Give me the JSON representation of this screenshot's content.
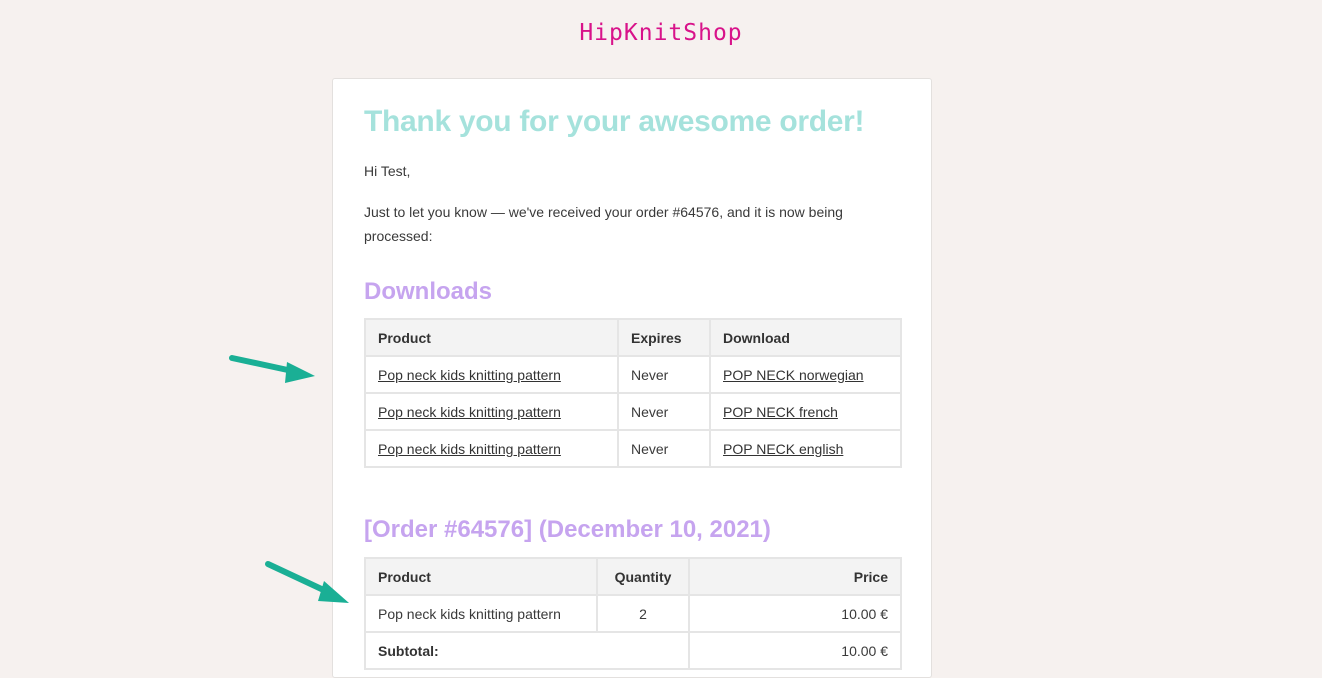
{
  "shop": {
    "logo": "HipKnitShop"
  },
  "email": {
    "heading": "Thank you for your awesome order!",
    "greeting": "Hi Test,",
    "intro": "Just to let you know — we've received your order #64576, and it is now being processed:"
  },
  "downloads": {
    "title": "Downloads",
    "headers": {
      "product": "Product",
      "expires": "Expires",
      "download": "Download"
    },
    "rows": [
      {
        "product": "Pop neck kids knitting pattern",
        "expires": "Never",
        "download": "POP NECK norwegian"
      },
      {
        "product": "Pop neck kids knitting pattern",
        "expires": "Never",
        "download": "POP NECK french"
      },
      {
        "product": "Pop neck kids knitting pattern",
        "expires": "Never",
        "download": "POP NECK english"
      }
    ]
  },
  "order": {
    "title": "[Order #64576] (December 10, 2021)",
    "headers": {
      "product": "Product",
      "quantity": "Quantity",
      "price": "Price"
    },
    "items": [
      {
        "product": "Pop neck kids knitting pattern",
        "quantity": "2",
        "price": "10.00 €"
      }
    ],
    "subtotal": {
      "label": "Subtotal:",
      "value": "10.00 €"
    }
  },
  "colors": {
    "background": "#f6f1ef",
    "logo": "#d8138a",
    "heading": "#a5e2dc",
    "section_title": "#c6a4ef",
    "arrow": "#1aaf95"
  },
  "icons": {
    "annotation": "arrow-right-icon"
  }
}
